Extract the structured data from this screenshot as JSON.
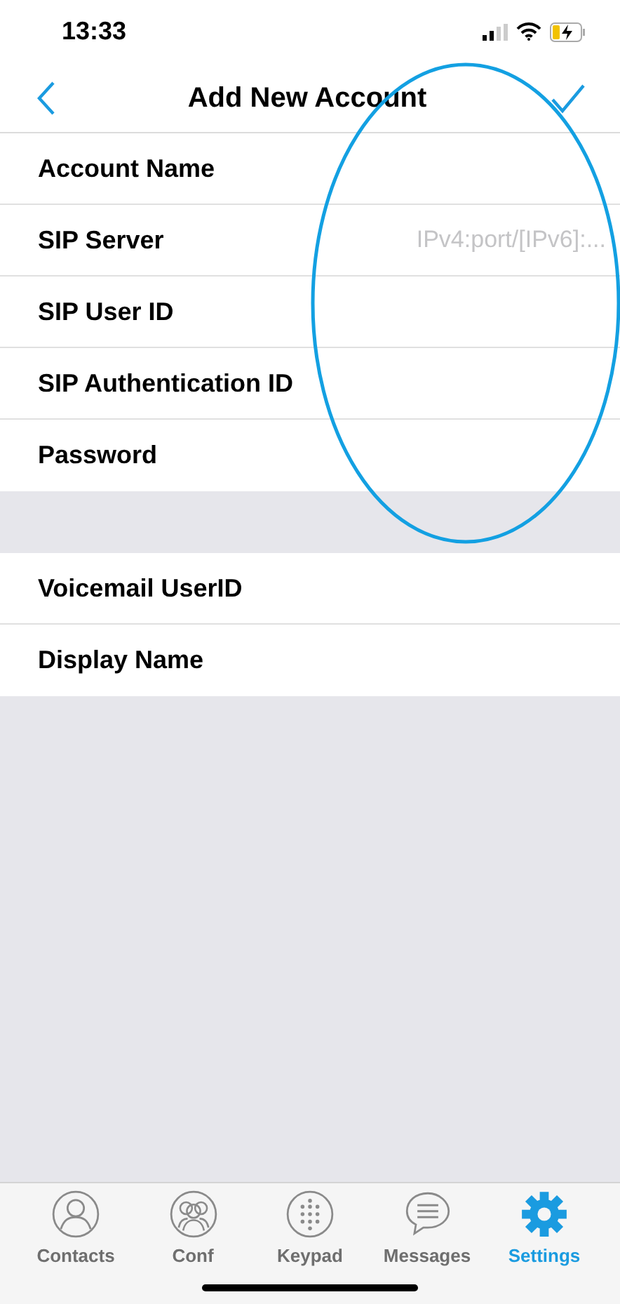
{
  "status_bar": {
    "time": "13:33"
  },
  "nav": {
    "title": "Add New Account"
  },
  "sections": [
    {
      "fields": [
        {
          "label": "Account Name"
        },
        {
          "label": "SIP Server",
          "placeholder": "IPv4:port/[IPv6]:..."
        },
        {
          "label": "SIP User ID"
        },
        {
          "label": "SIP Authentication ID"
        },
        {
          "label": "Password"
        }
      ]
    },
    {
      "fields": [
        {
          "label": "Voicemail UserID"
        },
        {
          "label": "Display Name"
        }
      ]
    }
  ],
  "tabs": [
    {
      "label": "Contacts",
      "kind": "contacts",
      "selected": false
    },
    {
      "label": "Conf",
      "kind": "conf",
      "selected": false
    },
    {
      "label": "Keypad",
      "kind": "keypad",
      "selected": false
    },
    {
      "label": "Messages",
      "kind": "messages",
      "selected": false
    },
    {
      "label": "Settings",
      "kind": "settings",
      "selected": true
    }
  ]
}
